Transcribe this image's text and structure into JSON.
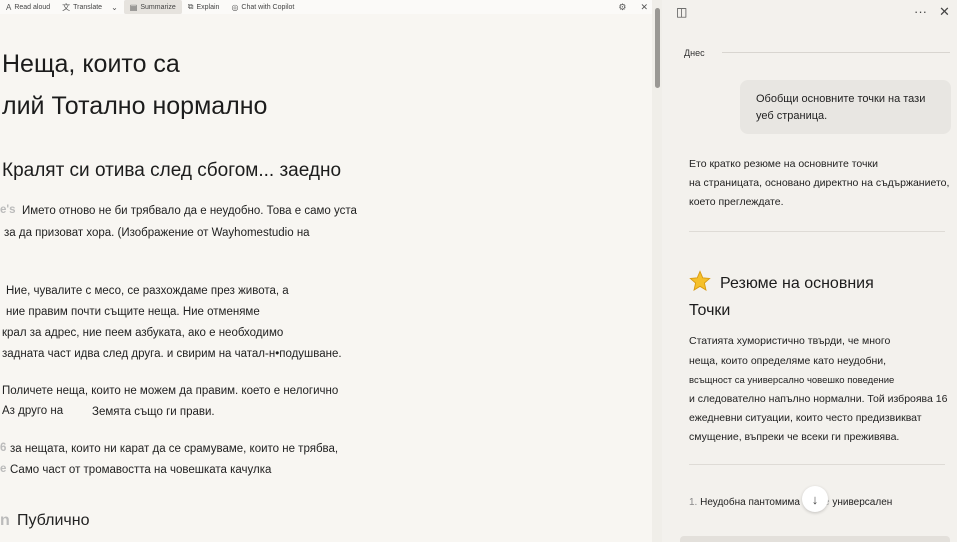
{
  "toolbar": {
    "read_aloud": "Read aloud",
    "translate": "Translate",
    "summarize": "Summarize",
    "explain": "Explain",
    "chat": "Chat with Copilot"
  },
  "article": {
    "title_line1": "Неща, които са",
    "title_line2": "лий Тотално нормално",
    "subtitle": "Кралят си отива след сбогом... заедно",
    "p1_prefix": "e's",
    "p1_line1": "Името отново не би трябвало да е неудобно. Това е само уста",
    "p1_line2": "за да призоват хора. (Изображение от Wayhomestudio на",
    "p2_line1": "Ние, чувалите с месо, се разхождаме през живота, а",
    "p2_line2": "ние правим почти същите неща. Ние отменяме",
    "p2_line3": "крал за адрес, ние пеем азбуката, ако е необходимо",
    "p2_line4": "задната част идва след друга. и свирим на чатал-н•подушване.",
    "p3_line1": "Поличете неща, които не можем да правим. което е нелогично",
    "p3_line2a": "Аз друго на",
    "p3_line2b": "Земята също ги прави.",
    "p4_prefix": "6",
    "p4_line1": "за нещата, които ни карат да се срамуваме, които не трябва,",
    "p4_prefix2": "e",
    "p4_line2": "Само част от тромавостта на човешката качулка",
    "section_prefix": "n",
    "section": "Публично"
  },
  "panel": {
    "date_label": "Днес",
    "user_msg_line1": "Обобщи основните точки на тази",
    "user_msg_line2": "уеб страница.",
    "resp_line1": "Ето кратко резюме на основните точки",
    "resp_line2": "на страницата, основано директно на съдържанието,",
    "resp_line3": "което преглеждате.",
    "summary_title_line1": "Резюме на основния",
    "summary_title_line2": "Точки",
    "sum_line1": "Статията хумористично твърди, че много",
    "sum_line2": "неща, които определяме като неудобни,",
    "sum_line3": "всъщност са универсално човешко поведение",
    "sum_line4": "и следователно напълно нормални. Той изброява 16",
    "sum_line5": "ежедневни ситуации, които често предизвикват",
    "sum_line6": "смущение, въпреки че всеки ги преживява.",
    "list_num": "1.",
    "list_text": "Неудобна пантомима",
    "list_ghost": "re",
    "list_tail": "универсален"
  },
  "icons": {
    "read_aloud": "read-aloud-icon",
    "translate": "translate-icon",
    "summarize": "summarize-icon",
    "explain": "explain-icon",
    "chat": "chat-icon",
    "settings": "gear-icon",
    "close": "close-icon",
    "sidebar": "sidebar-toggle-icon",
    "more": "more-icon",
    "star": "star-icon",
    "scroll_down": "arrow-down-icon"
  }
}
